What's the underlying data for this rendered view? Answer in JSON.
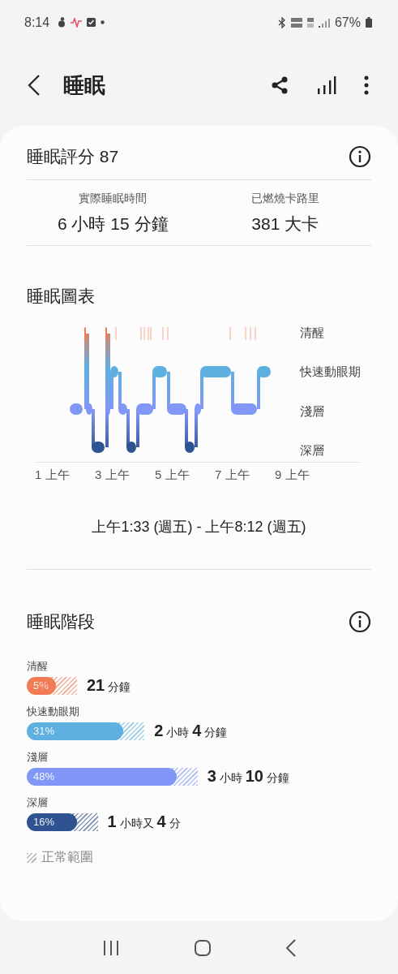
{
  "status_bar": {
    "time": "8:14",
    "battery": "67%"
  },
  "header": {
    "title": "睡眠"
  },
  "score": {
    "title": "睡眠評分 87"
  },
  "stats": [
    {
      "label": "實際睡眠時間",
      "value": "6 小時 15 分鐘"
    },
    {
      "label": "已燃燒卡路里",
      "value": "381 大卡"
    }
  ],
  "chart": {
    "title": "睡眠圖表",
    "stage_labels": [
      "清醒",
      "快速動眼期",
      "淺層",
      "深層"
    ],
    "time_labels": [
      "1 上午",
      "3 上午",
      "5 上午",
      "7 上午",
      "9 上午"
    ],
    "range": "上午1:33 (週五) - 上午8:12 (週五)"
  },
  "stages": {
    "title": "睡眠階段",
    "legend": "正常範圍",
    "items": [
      {
        "label": "清醒",
        "percent": "5%",
        "duration": "**21** 分鐘",
        "color": "#f07b55"
      },
      {
        "label": "快速動眼期",
        "percent": "31%",
        "duration": "**2** 小時 **4** 分鐘",
        "color": "#5eb0e0"
      },
      {
        "label": "淺層",
        "percent": "48%",
        "duration": "**3** 小時 **10** 分鐘",
        "color": "#8197f7"
      },
      {
        "label": "深層",
        "percent": "16%",
        "duration": "**1** 小時又 **4** 分",
        "color": "#2f5290"
      }
    ]
  }
}
